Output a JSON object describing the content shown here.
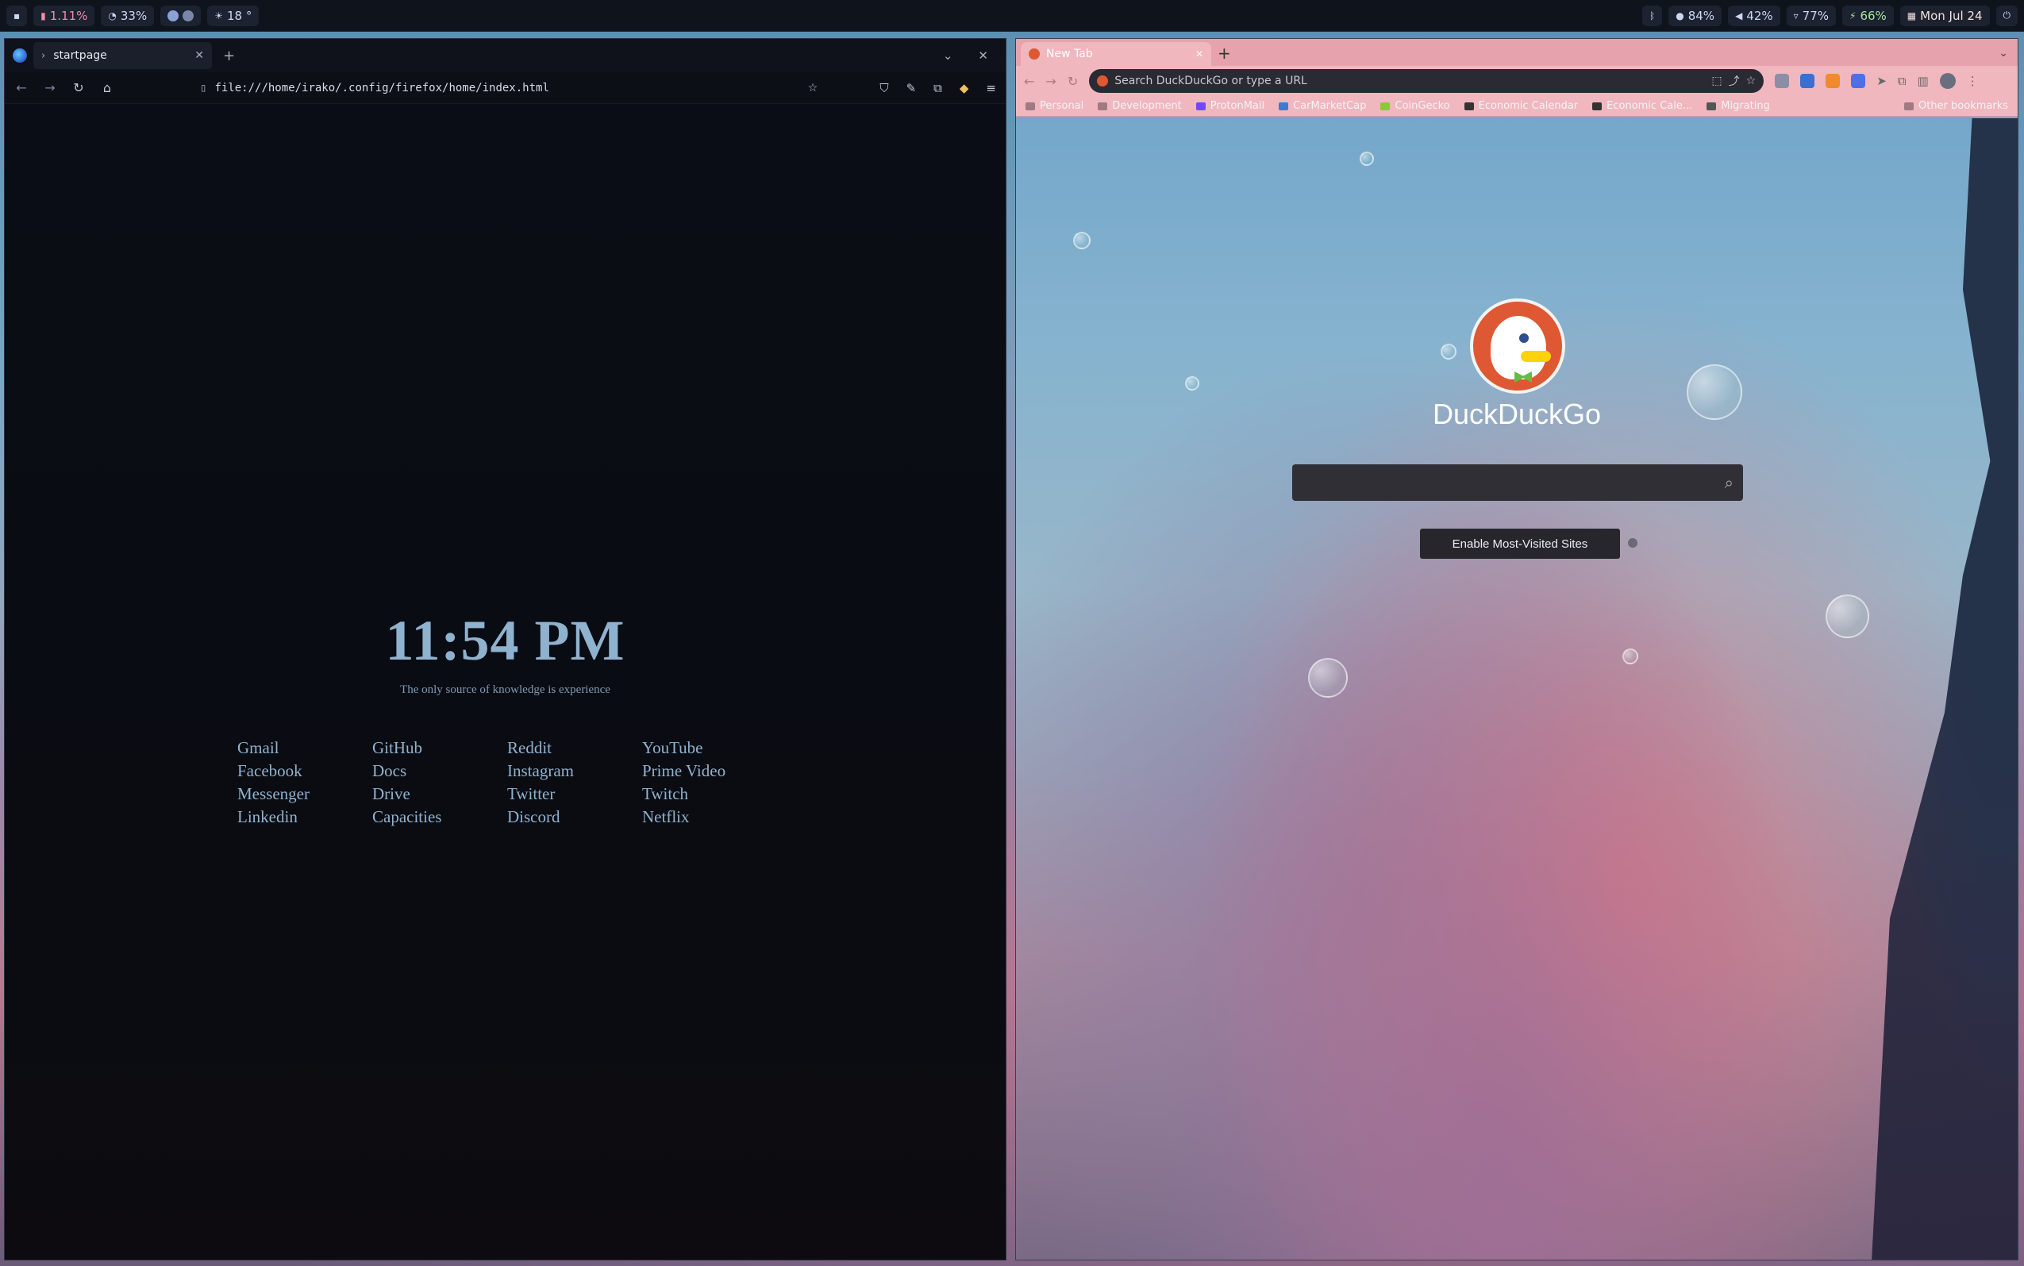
{
  "topbar": {
    "left": {
      "cpu": "1.11%",
      "memory": "33%",
      "weather": "18 °"
    },
    "right": {
      "brightness": "84%",
      "volume": "42%",
      "wifi": "77%",
      "battery": "66%",
      "date": "Mon Jul 24"
    }
  },
  "firefox": {
    "tab_label": "startpage",
    "url": "file:///home/irako/.config/firefox/home/index.html"
  },
  "startpage": {
    "clock": "11:54 PM",
    "quote": "The only source of knowledge is experience",
    "columns": [
      [
        "Gmail",
        "Facebook",
        "Messenger",
        "Linkedin"
      ],
      [
        "GitHub",
        "Docs",
        "Drive",
        "Capacities"
      ],
      [
        "Reddit",
        "Instagram",
        "Twitter",
        "Discord"
      ],
      [
        "YouTube",
        "Prime Video",
        "Twitch",
        "Netflix"
      ]
    ]
  },
  "chrome": {
    "tab_label": "New Tab",
    "omnibox_placeholder": "Search DuckDuckGo or type a URL",
    "bookmarks": [
      "Personal",
      "Development",
      "ProtonMail",
      "CarMarketCap",
      "CoinGecko",
      "Economic Calendar",
      "Economic Cale...",
      "Migrating"
    ],
    "other_bookmarks": "Other bookmarks"
  },
  "ddg": {
    "name": "DuckDuckGo",
    "enable_label": "Enable Most-Visited Sites"
  },
  "colors": {
    "clock": "#8fb2cf",
    "ddg_orange": "#de5833",
    "chrome_theme": "#f0b7bf"
  }
}
